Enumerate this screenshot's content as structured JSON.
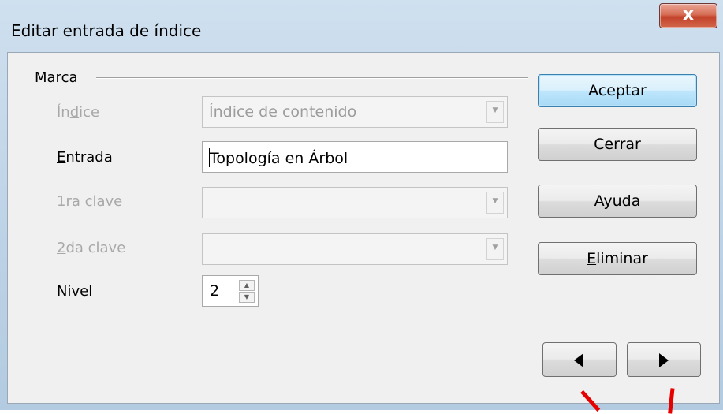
{
  "window": {
    "title": "Editar entrada de índice",
    "close_label": "x"
  },
  "marca": {
    "label": "Marca",
    "indice": {
      "label_pre": "Ín",
      "label_u": "d",
      "label_post": "ice",
      "value": "Índice de contenido",
      "enabled": false
    },
    "entrada": {
      "label_u": "E",
      "label_post": "ntrada",
      "value": "Topología en Árbol"
    },
    "clave1": {
      "label_u": "1",
      "label_post": "ra clave",
      "value": "",
      "enabled": false
    },
    "clave2": {
      "label_u": "2",
      "label_post": "da clave",
      "value": "",
      "enabled": false
    },
    "nivel": {
      "label_u": "N",
      "label_post": "ivel",
      "value": "2"
    }
  },
  "buttons": {
    "aceptar": "Aceptar",
    "cerrar": "Cerrar",
    "ayuda_pre": "Ay",
    "ayuda_u": "u",
    "ayuda_post": "da",
    "eliminar_u": "E",
    "eliminar_post": "liminar"
  },
  "icons": {
    "prev": "triangle-left",
    "next": "triangle-right",
    "dropdown": "chevron-down",
    "spin_up": "triangle-up",
    "spin_down": "triangle-down"
  },
  "colors": {
    "annotation": "#e60000",
    "default_button_border": "#3c7fb1",
    "close_button": "#c2432a"
  }
}
